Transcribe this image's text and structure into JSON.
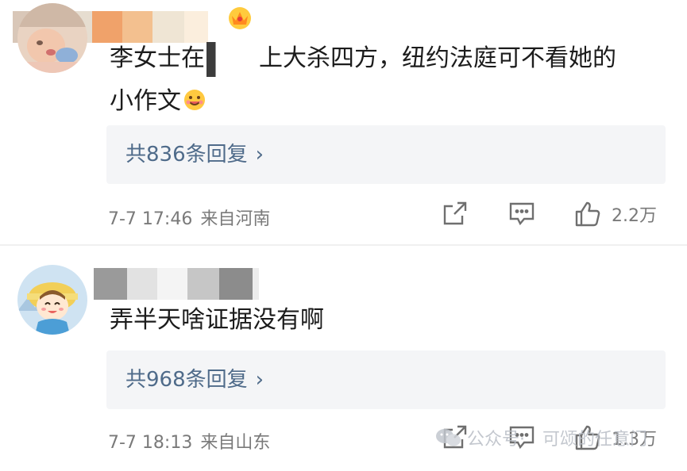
{
  "comments": [
    {
      "text": "李女士在",
      "text_rest": "上大杀四方，纽约法庭可不看她的",
      "text_line2": "小作文",
      "replies": "共836条回复",
      "reply_arrow": "›",
      "time": "7-7 17:46",
      "source": "来自河南",
      "likes": "2.2万"
    },
    {
      "text": "弄半天啥证据没有啊",
      "replies": "共968条回复",
      "reply_arrow": "›",
      "time": "7-7 18:13",
      "source": "来自山东",
      "likes": "1.3万"
    }
  ],
  "watermark": {
    "platform": "公众号·",
    "account": "可颂的任意门"
  },
  "colors": {
    "reply_link": "#4f6b8a",
    "meta_text": "#7a7a7a",
    "reply_bg": "#f4f5f7"
  },
  "icons": {
    "share": "share-edit-icon",
    "comment": "comment-bubble-icon",
    "like": "thumbs-up-icon",
    "badge": "crown-badge-icon",
    "emoji": "smiling-emoji-icon"
  }
}
